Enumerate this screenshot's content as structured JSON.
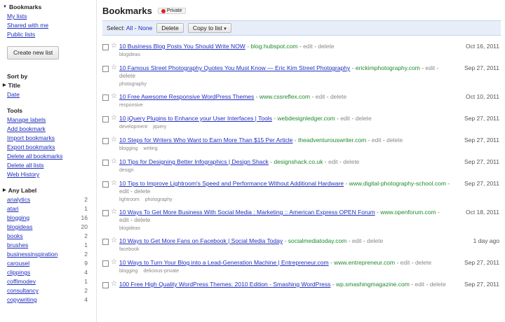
{
  "sidebar": {
    "bookmarks_header": "Bookmarks",
    "bookmarks_links": [
      "My lists",
      "Shared with me",
      "Public lists"
    ],
    "create_list": "Create new list",
    "sort_by_header": "Sort by",
    "sort_title": "Title",
    "sort_date": "Date",
    "tools_header": "Tools",
    "tools": [
      "Manage labels",
      "Add bookmark",
      "Import bookmarks",
      "Export bookmarks",
      "Delete all bookmarks",
      "Delete all lists",
      "Web History"
    ],
    "any_label_header": "Any Label",
    "labels": [
      {
        "name": "analytics",
        "count": "2"
      },
      {
        "name": "atari",
        "count": "1"
      },
      {
        "name": "blogging",
        "count": "16"
      },
      {
        "name": "blogideas",
        "count": "20"
      },
      {
        "name": "books",
        "count": "2"
      },
      {
        "name": "brushes",
        "count": "1"
      },
      {
        "name": "businessinspiration",
        "count": "2"
      },
      {
        "name": "carousel",
        "count": "9"
      },
      {
        "name": "clippings",
        "count": "4"
      },
      {
        "name": "coffimodev",
        "count": "1"
      },
      {
        "name": "consultancy",
        "count": "2"
      },
      {
        "name": "copywriting",
        "count": "4"
      }
    ]
  },
  "main": {
    "title": "Bookmarks",
    "private_badge": "Private",
    "toolbar": {
      "select_label": "Select:",
      "select_all": "All",
      "select_dash": "-",
      "select_none": "None",
      "delete_button": "Delete",
      "copy_to_list": "Copy to list",
      "copy_arrow": "▾"
    },
    "separator": " - ",
    "edit_label": "edit",
    "delete_label": "delete",
    "items": [
      {
        "title": "10 Business Blog Posts You Should Write NOW",
        "domain": "blog.hubspot.com",
        "tags": [
          "blogideas"
        ],
        "date": "Oct 16, 2011"
      },
      {
        "title": "10 Famous Street Photography Quotes You Must Know — Eric Kim Street Photography",
        "domain": "erickimphotography.com",
        "tags": [
          "photography"
        ],
        "date": "Sep 27, 2011"
      },
      {
        "title": "10 Free Awesome Responsive WordPress Themes",
        "domain": "www.cssreflex.com",
        "tags": [
          "responsive"
        ],
        "date": "Oct 10, 2011"
      },
      {
        "title": "10 jQuery Plugins to Enhance your User Interfaces | Tools",
        "domain": "webdesignledger.com",
        "tags": [
          "development",
          "jquery"
        ],
        "date": "Sep 27, 2011"
      },
      {
        "title": "10 Steps for Writers Who Want to Earn More Than $15 Per Article",
        "domain": "theadventurouswriter.com",
        "tags": [
          "blogging",
          "writing"
        ],
        "date": "Sep 27, 2011"
      },
      {
        "title": "10 Tips for Designing Better Infographics | Design Shack",
        "domain": "designshack.co.uk",
        "tags": [
          "design"
        ],
        "date": "Sep 27, 2011"
      },
      {
        "title": "10 Tips to Improve Lightroom's Speed and Performance Without Additional Hardware",
        "domain": "www.digital-photography-school.com",
        "tags": [
          "lightroom",
          "photography"
        ],
        "date": "Sep 27, 2011"
      },
      {
        "title": "10 Ways To Get More Business With Social Media : Marketing :: American Express OPEN Forum",
        "domain": "www.openforum.com",
        "tags": [
          "blogideas"
        ],
        "date": "Oct 18, 2011"
      },
      {
        "title": "10 Ways to Get More Fans on Facebook | Social Media Today",
        "domain": "socialmediatoday.com",
        "tags": [
          "facebook"
        ],
        "date": "1 day ago"
      },
      {
        "title": "10 Ways to Turn Your Blog into a Lead-Generation Machine | Entrepreneur.com",
        "domain": "www.entrepreneur.com",
        "tags": [
          "blogging",
          "delicious-private"
        ],
        "date": "Sep 27, 2011"
      },
      {
        "title": "100 Free High Quality WordPress Themes: 2010 Edition - Smashing WordPress",
        "domain": "wp.smashingmagazine.com",
        "tags": [],
        "date": "Sep 27, 2011"
      }
    ]
  }
}
